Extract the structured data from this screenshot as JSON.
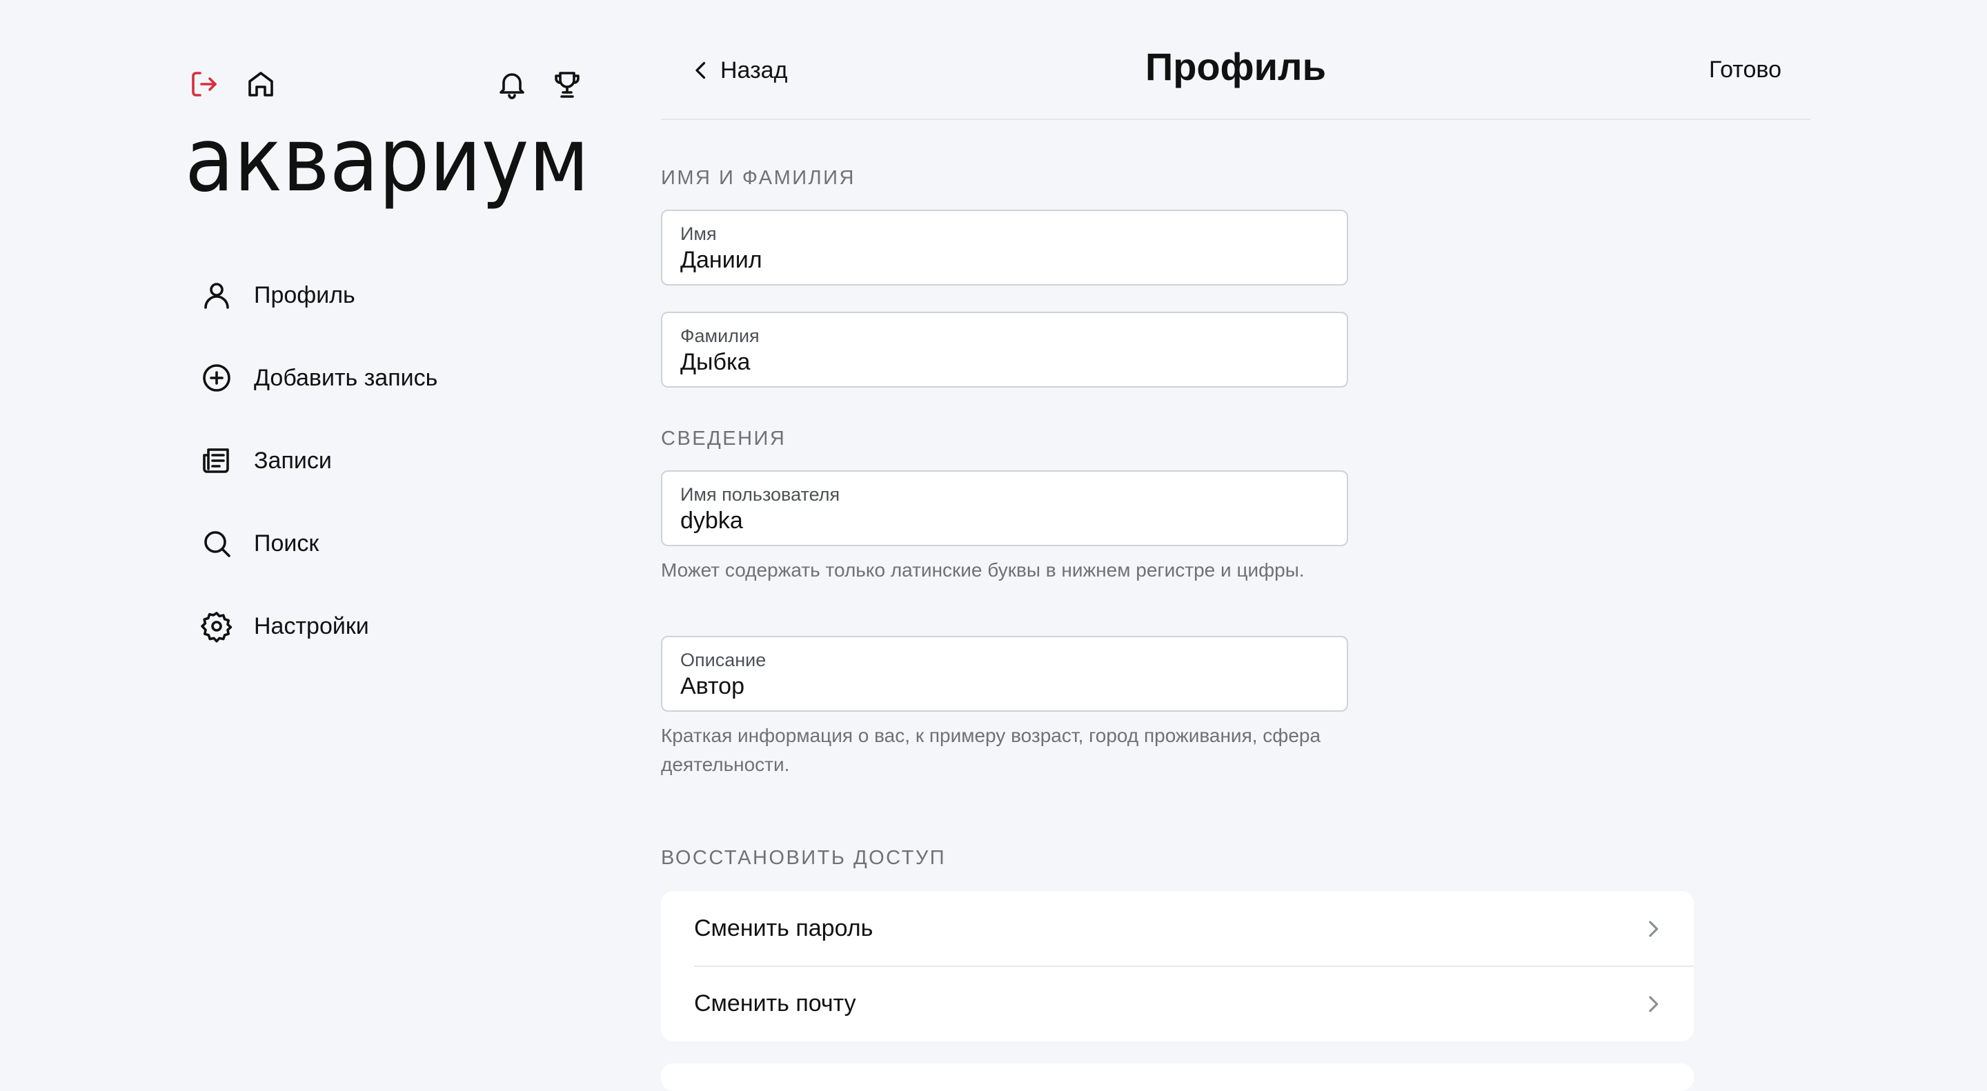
{
  "sidebar": {
    "logo_text": "аквариум",
    "top_icons": [
      "logout-icon",
      "home-icon",
      "bell-icon",
      "trophy-icon"
    ],
    "items": [
      {
        "label": "Профиль",
        "icon": "user-icon"
      },
      {
        "label": "Добавить запись",
        "icon": "plus-circle-icon"
      },
      {
        "label": "Записи",
        "icon": "newspaper-icon"
      },
      {
        "label": "Поиск",
        "icon": "search-icon"
      },
      {
        "label": "Настройки",
        "icon": "gear-icon"
      }
    ]
  },
  "header": {
    "back_label": "Назад",
    "title": "Профиль",
    "done_label": "Готово"
  },
  "sections": {
    "name_title": "ИМЯ И ФАМИЛИЯ",
    "info_title": "СВЕДЕНИЯ",
    "restore_title": "ВОССТАНОВИТЬ ДОСТУП"
  },
  "fields": {
    "first_name": {
      "label": "Имя",
      "value": "Даниил"
    },
    "last_name": {
      "label": "Фамилия",
      "value": "Дыбка"
    },
    "username": {
      "label": "Имя пользователя",
      "value": "dybka",
      "hint": "Может содержать только латинские буквы в нижнем регистре и цифры."
    },
    "description": {
      "label": "Описание",
      "value": "Автор",
      "hint": "Краткая информация о вас, к примеру возраст, город проживания, сфера деятельности."
    }
  },
  "restore": {
    "items": [
      {
        "label": "Сменить пароль"
      },
      {
        "label": "Сменить почту"
      }
    ]
  },
  "colors": {
    "background": "#f5f6f9",
    "logout_accent": "#d6303d",
    "text": "#111111",
    "muted": "#6e7177"
  }
}
